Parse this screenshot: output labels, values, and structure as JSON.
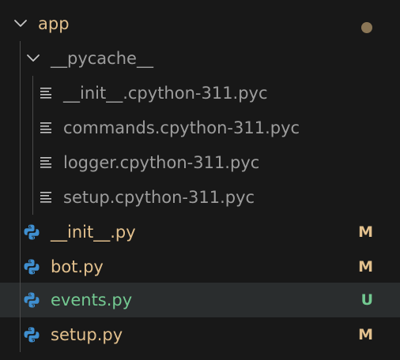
{
  "explorer": {
    "folder": {
      "name": "app",
      "expanded_icon": "chevron-down-icon",
      "modified_indicator": "dot",
      "color": "#e2c08d",
      "dot_color": "#8a7656"
    },
    "subfolder": {
      "name": "__pycache__",
      "expanded_icon": "chevron-down-icon",
      "color": "#9d9d9d"
    },
    "cache_files": [
      {
        "name": "__init__.cpython-311.pyc",
        "icon": "file-lines-icon"
      },
      {
        "name": "commands.cpython-311.pyc",
        "icon": "file-lines-icon"
      },
      {
        "name": "logger.cpython-311.pyc",
        "icon": "file-lines-icon"
      },
      {
        "name": "setup.cpython-311.pyc",
        "icon": "file-lines-icon"
      }
    ],
    "files": [
      {
        "name": "__init__.py",
        "icon": "python-icon",
        "status": "M",
        "color": "#e2c08d"
      },
      {
        "name": "bot.py",
        "icon": "python-icon",
        "status": "M",
        "color": "#e2c08d"
      },
      {
        "name": "events.py",
        "icon": "python-icon",
        "status": "U",
        "color": "#73c991",
        "selected": true
      },
      {
        "name": "setup.py",
        "icon": "python-icon",
        "status": "M",
        "color": "#e2c08d"
      }
    ]
  },
  "colors": {
    "background": "#181818",
    "selected_row": "#2a2d2e",
    "pyc_text": "#9d9d9d",
    "modified": "#e2c08d",
    "untracked": "#73c991",
    "python_icon": "#3f8fd0",
    "guide": "#4a4a4a"
  }
}
